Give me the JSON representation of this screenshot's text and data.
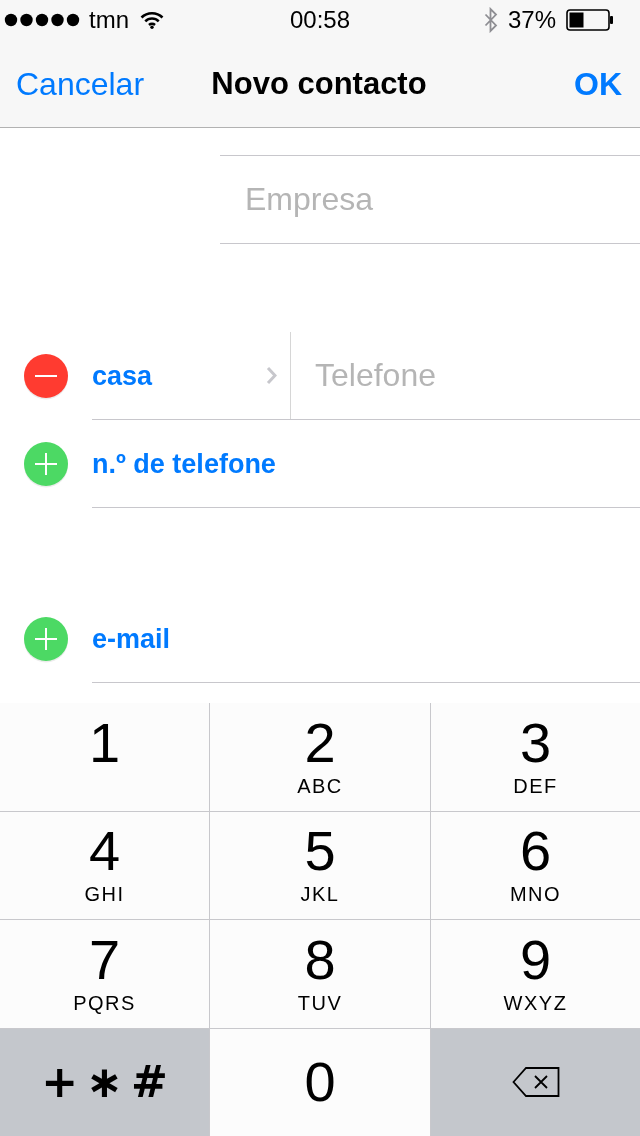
{
  "status_bar": {
    "carrier": "tmn",
    "time": "00:58",
    "battery": "37%"
  },
  "nav_bar": {
    "left_button": "Cancelar",
    "title": "Novo contacto",
    "right_button": "OK"
  },
  "company_field": {
    "placeholder": "Empresa"
  },
  "sections": [
    {
      "rows": [
        {
          "kind": "remove",
          "label": "casa",
          "placeholder": "Telefone"
        },
        {
          "kind": "add",
          "label": "n.º de telefone"
        }
      ]
    },
    {
      "rows": [
        {
          "kind": "add",
          "label": "e-mail"
        }
      ]
    }
  ],
  "keypad": {
    "keys": [
      {
        "kind": "digit",
        "digit": "1"
      },
      {
        "kind": "digit",
        "digit": "2",
        "letters": "ABC"
      },
      {
        "kind": "digit",
        "digit": "3",
        "letters": "DEF"
      },
      {
        "kind": "digit",
        "digit": "4",
        "letters": "GHI"
      },
      {
        "kind": "digit",
        "digit": "5",
        "letters": "JKL"
      },
      {
        "kind": "digit",
        "digit": "6",
        "letters": "MNO"
      },
      {
        "kind": "digit",
        "digit": "7",
        "letters": "PQRS"
      },
      {
        "kind": "digit",
        "digit": "8",
        "letters": "TUV"
      },
      {
        "kind": "digit",
        "digit": "9",
        "letters": "WXYZ"
      },
      {
        "kind": "symbols",
        "label": "+∗#"
      },
      {
        "kind": "plain",
        "digit": "0"
      },
      {
        "kind": "delete"
      }
    ]
  }
}
